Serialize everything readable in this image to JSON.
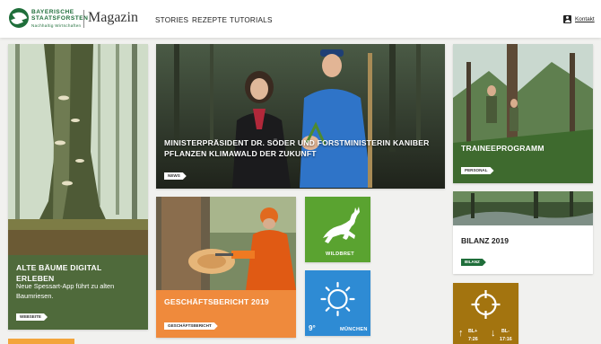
{
  "header": {
    "logo_line1": "BAYERISCHE",
    "logo_line2": "STAATSFORSTEN",
    "logo_tagline": "Nachhaltig Wirtschaften",
    "magazin": "Magazin",
    "nav": [
      "STORIES",
      "REZEPTE",
      "TUTORIALS"
    ],
    "contact_label": "Kontakt"
  },
  "cards": {
    "baeume": {
      "title": "ALTE BÄUME DIGITAL ERLEBEN",
      "text": "Neue Spessart-App führt zu alten Baumriesen.",
      "tag": "WEBSEITE",
      "color": "#4f6a3b"
    },
    "klimawald": {
      "title": "MINISTERPRÄSIDENT DR. SÖDER UND FORSTMINISTERIN KANIBER PFLANZEN KLIMAWALD DER ZUKUNFT",
      "tag": "NEWS"
    },
    "trainee": {
      "title": "TRAINEEPROGRAMM",
      "tag": "PERSONAL"
    },
    "bilanz": {
      "title": "BILANZ 2019",
      "tag": "BILANZ"
    },
    "geschaeft": {
      "title": "GESCHÄFTSBERICHT 2019",
      "tag": "GESCHÄFTSBERICHT",
      "color": "#ef8a3c"
    },
    "wildbret": {
      "label": "WILDBRET",
      "icon": "deer-icon",
      "color": "#5aa330"
    },
    "weather": {
      "temperature": "9°",
      "city": "MÜNCHEN",
      "icon": "sun-icon",
      "color": "#2e8bd4"
    },
    "hunting": {
      "icon": "crosshair-icon",
      "sunrise_label": "BL+",
      "sunrise_time": "7:26",
      "sunset_label": "BL-",
      "sunset_time": "17:16",
      "color": "#a3740f"
    }
  }
}
